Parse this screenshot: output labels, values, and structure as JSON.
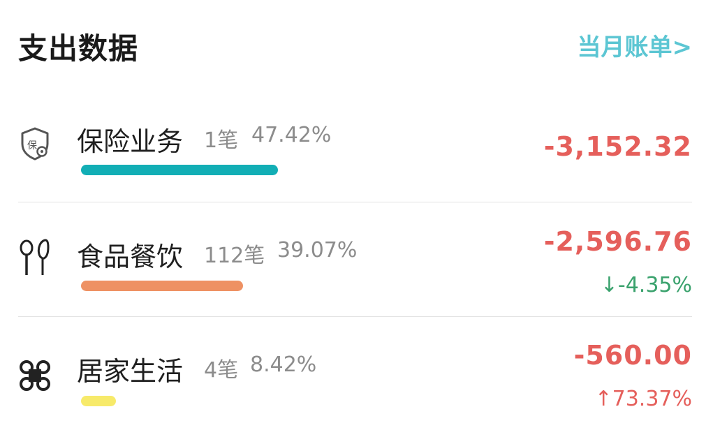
{
  "header": {
    "title": "支出数据",
    "link_label": "当月账单>"
  },
  "colors": {
    "accent_link": "#5cc6d3",
    "amount_red": "#e55f5b",
    "down_green": "#3aa26d",
    "up_red": "#e55f5b"
  },
  "rows": [
    {
      "icon": "insurance-shield-icon",
      "icon_text": "保",
      "name": "保险业务",
      "count": "1笔",
      "percent": "47.42%",
      "share": 0.4742,
      "bar_color": "#12aeb5",
      "amount": "-3,152.32",
      "change": ""
    },
    {
      "icon": "food-utensils-icon",
      "name": "食品餐饮",
      "count": "112笔",
      "percent": "39.07%",
      "share": 0.3907,
      "bar_color": "#ee9163",
      "amount": "-2,596.76",
      "change": "↓-4.35%",
      "change_color": "#3aa26d"
    },
    {
      "icon": "home-life-clover-icon",
      "name": "居家生活",
      "count": "4笔",
      "percent": "8.42%",
      "share": 0.0842,
      "bar_color": "#f7ea6a",
      "amount": "-560.00",
      "change": "↑73.37%",
      "change_color": "#e55f5b"
    }
  ]
}
